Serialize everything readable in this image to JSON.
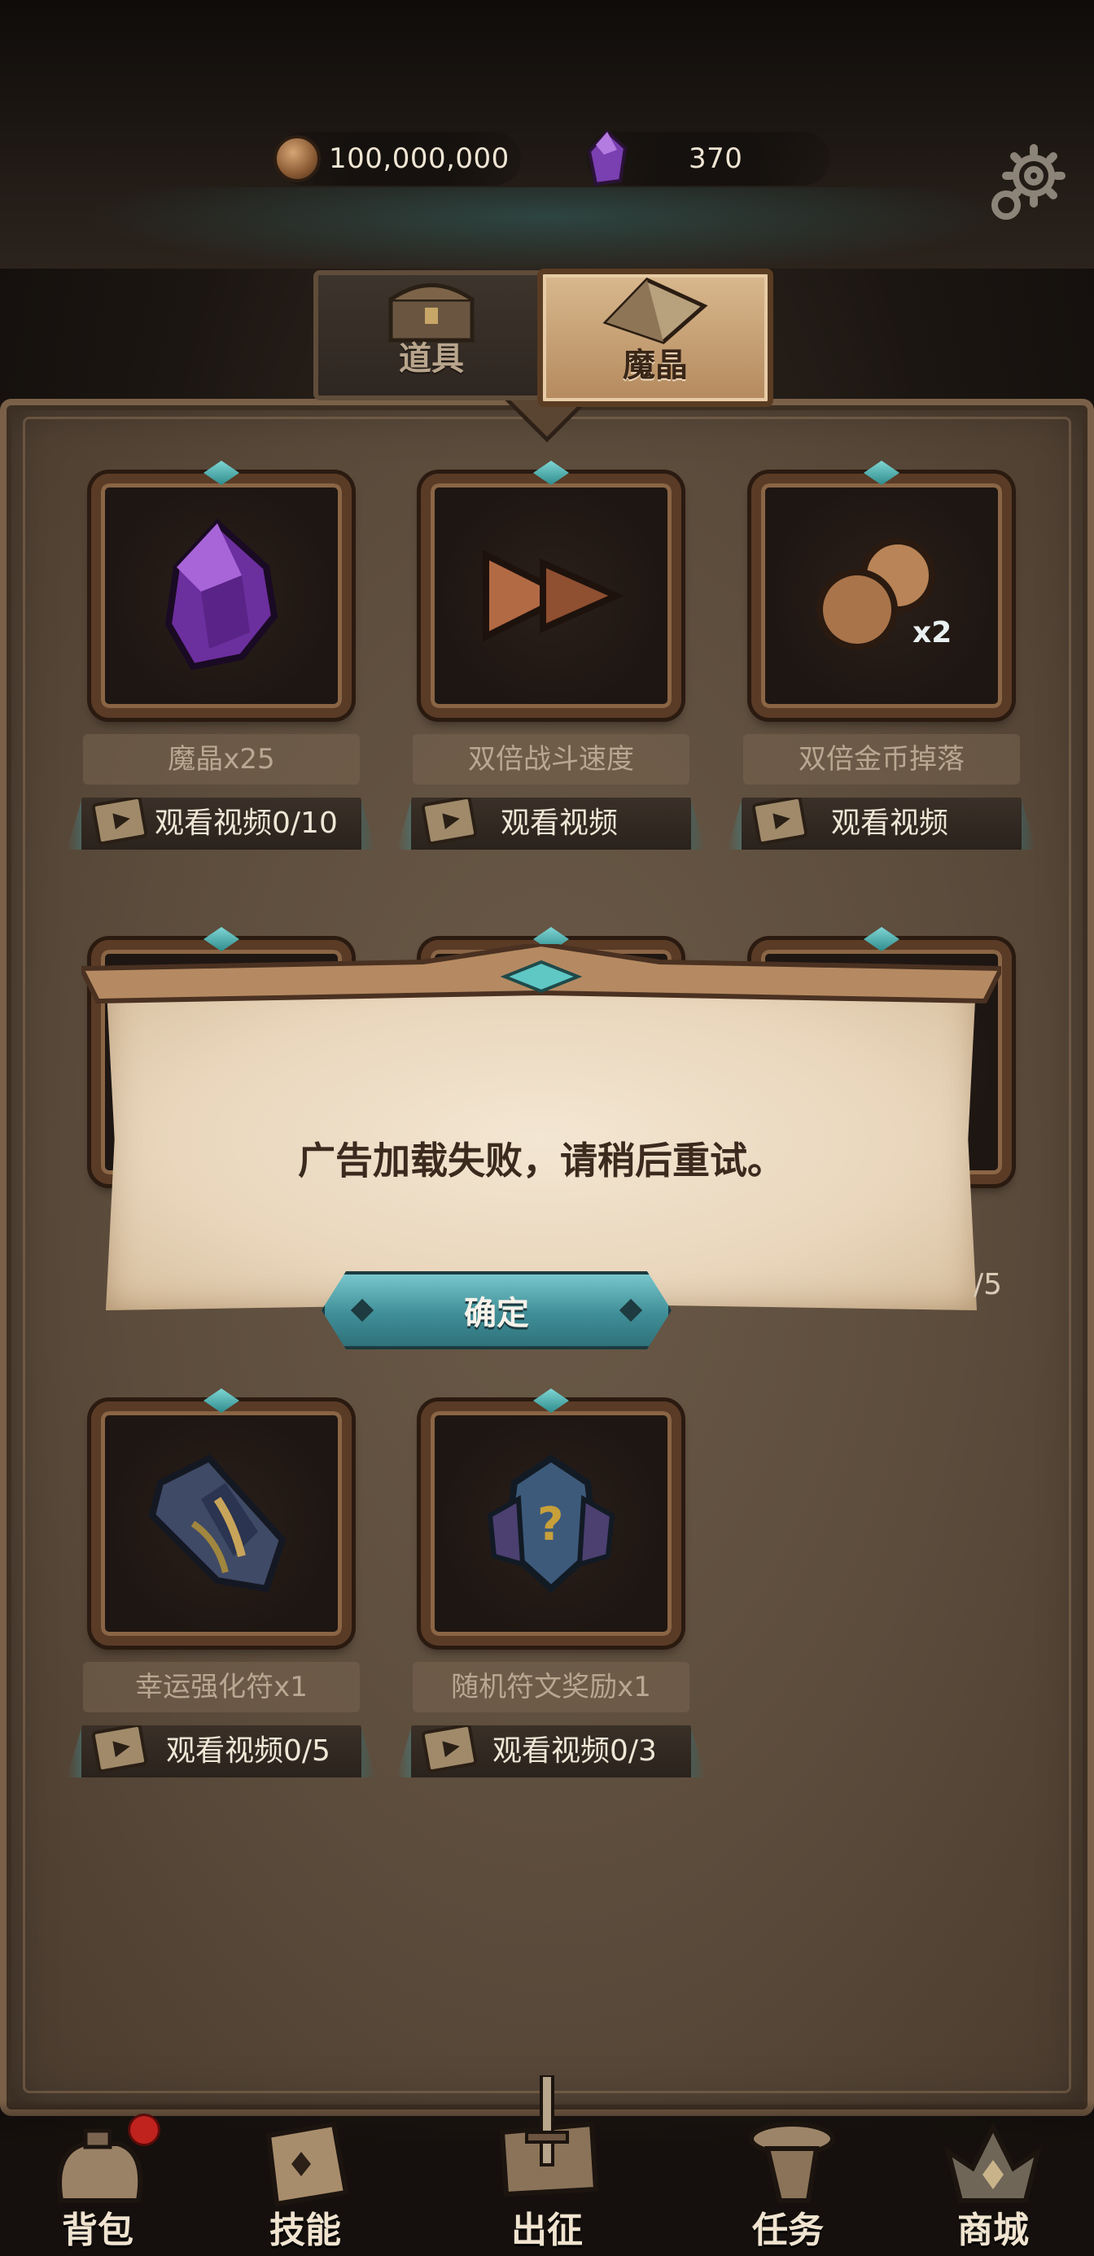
{
  "header": {
    "gold_amount": "100,000,000",
    "crystal_amount": "370",
    "settings_icon": "gear-icon"
  },
  "tabs": [
    {
      "label": "道具",
      "icon": "chest-icon",
      "active": false
    },
    {
      "label": "魔晶",
      "icon": "crystal-icon",
      "active": true
    }
  ],
  "cards": [
    {
      "title": "魔晶x25",
      "watch": "观看视频0/10",
      "icon": "purple-crystal-icon"
    },
    {
      "title": "双倍战斗速度",
      "watch": "观看视频",
      "icon": "fast-forward-icon"
    },
    {
      "title": "双倍金币掉落",
      "watch": "观看视频",
      "icon": "double-coins-icon",
      "badge": "x2"
    },
    {
      "title": "幸运强化符x1",
      "watch": "观看视频0/5",
      "icon": "luck-rune-icon"
    },
    {
      "title": "随机符文奖励x1",
      "watch": "观看视频0/3",
      "icon": "random-rune-icon"
    }
  ],
  "dialog": {
    "message": "广告加载失败，请稍后重试。",
    "confirm_label": "确定"
  },
  "hidden_fragment": "/5",
  "nav": [
    {
      "label": "背包",
      "icon": "backpack-icon",
      "badge": true
    },
    {
      "label": "技能",
      "icon": "skill-book-icon"
    },
    {
      "label": "出征",
      "icon": "sword-map-icon"
    },
    {
      "label": "任务",
      "icon": "quest-scroll-icon"
    },
    {
      "label": "商城",
      "icon": "shop-crown-icon"
    }
  ],
  "colors": {
    "accent_teal": "#3d8f95",
    "panel_brown": "#5c4c3c",
    "badge_red": "#c0221e"
  }
}
